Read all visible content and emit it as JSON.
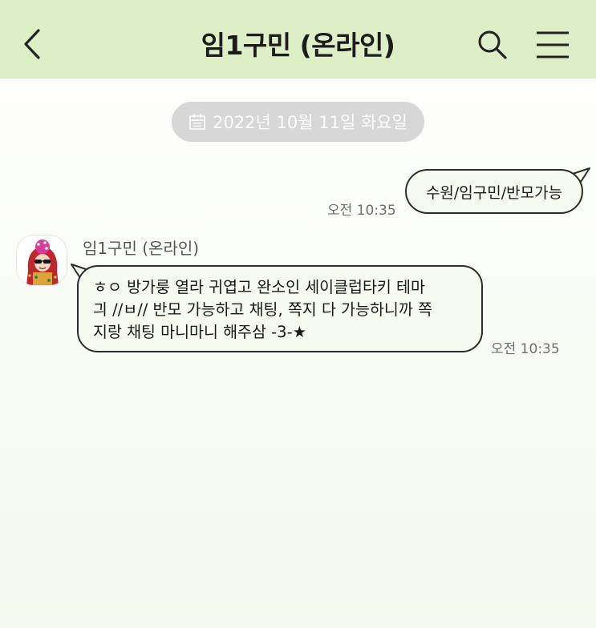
{
  "header": {
    "title": "임1구민 (온라인)",
    "back_icon": "chevron-left-icon",
    "search_icon": "search-icon",
    "menu_icon": "hamburger-menu-icon",
    "background": "#dcefc7"
  },
  "date_divider": {
    "text": "2022년 10월 11일 화요일",
    "icon": "calendar-icon"
  },
  "messages": [
    {
      "direction": "outgoing",
      "text": "수원/임구민/반모가능",
      "time": "오전 10:35"
    },
    {
      "direction": "incoming",
      "sender": "임1구민 (온라인)",
      "avatar": "avatar-cartoon-red-hood",
      "lines": [
        "ㅎㅇ 방가룽 열라 귀엽고 완소인 세이클럽타키 테마",
        "긔 //ㅂ//  반모 가능하고 채팅, 쪽지 다 가능하니까 쪽",
        "지랑 채팅 마니마니 해주삼 -3-★"
      ],
      "time": "오전 10:35"
    }
  ],
  "colors": {
    "bubble_fill": "#f5fbee",
    "bubble_border": "#2c2c2c",
    "date_pill": "#d7d7d7"
  }
}
